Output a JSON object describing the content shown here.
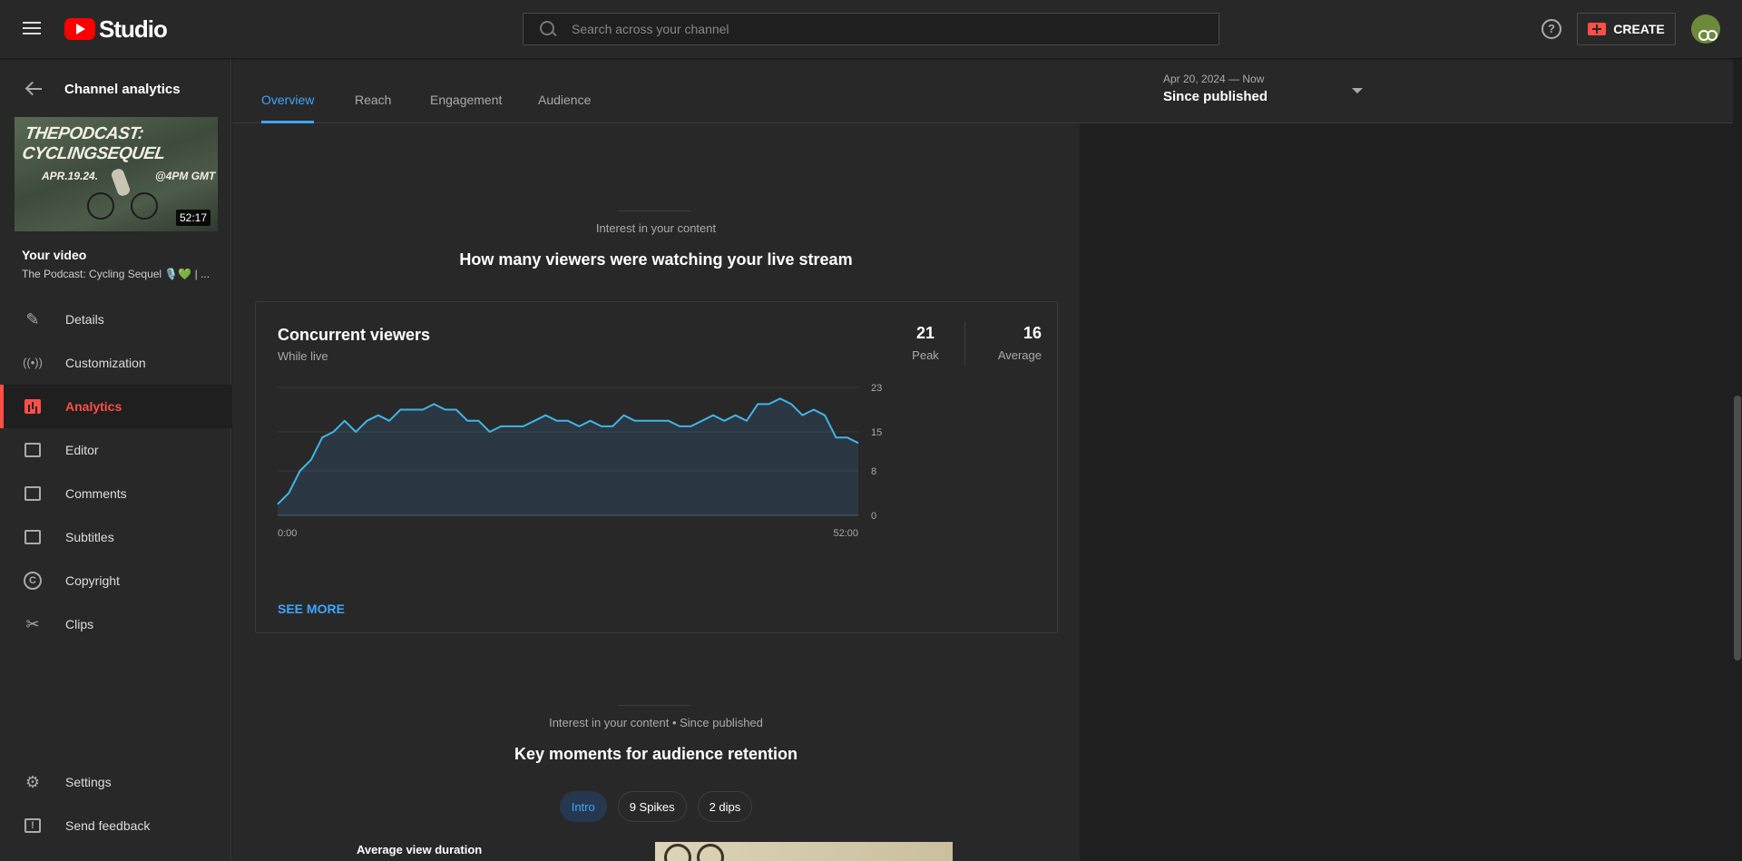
{
  "app": {
    "brand": "Studio",
    "search_placeholder": "Search across your channel",
    "help": "?",
    "create_label": "CREATE"
  },
  "sidebar": {
    "back_label": "Channel analytics",
    "thumbnail": {
      "title": "THEPODCAST: CYCLINGSEQUEL",
      "date": "APR.19.24.",
      "time": "@4PM GMT",
      "duration": "52:17"
    },
    "your_video_label": "Your video",
    "video_title": "The Podcast: Cycling Sequel 🎙️💚 | ...",
    "items": [
      {
        "label": "Details",
        "icon": "pencil-icon"
      },
      {
        "label": "Customization",
        "icon": "broadcast-icon"
      },
      {
        "label": "Analytics",
        "icon": "bar-chart-icon"
      },
      {
        "label": "Editor",
        "icon": "film-icon"
      },
      {
        "label": "Comments",
        "icon": "comment-icon"
      },
      {
        "label": "Subtitles",
        "icon": "subtitles-icon"
      },
      {
        "label": "Copyright",
        "icon": "copyright-icon"
      },
      {
        "label": "Clips",
        "icon": "scissors-icon"
      }
    ],
    "bottom_items": [
      {
        "label": "Settings",
        "icon": "gear-icon"
      },
      {
        "label": "Send feedback",
        "icon": "feedback-icon"
      }
    ]
  },
  "tabs": [
    {
      "label": "Overview",
      "active": true
    },
    {
      "label": "Reach",
      "active": false
    },
    {
      "label": "Engagement",
      "active": false
    },
    {
      "label": "Audience",
      "active": false
    }
  ],
  "date_range": {
    "sub": "Apr 20, 2024 — Now",
    "main": "Since published"
  },
  "section1": {
    "kicker": "Interest in your content",
    "title": "How many viewers were watching your live stream"
  },
  "card": {
    "title": "Concurrent viewers",
    "subtitle": "While live",
    "peak_value": "21",
    "peak_label": "Peak",
    "avg_value": "16",
    "avg_label": "Average",
    "see_more": "SEE MORE"
  },
  "chart_data": {
    "type": "area",
    "title": "",
    "xlabel": "",
    "ylabel": "",
    "x_tick_labels": [
      "0:00",
      "52:00"
    ],
    "y_ticks": [
      0,
      8,
      15,
      23
    ],
    "ylim": [
      0,
      23
    ],
    "grid": true,
    "color": "#3ea6ff",
    "values": [
      2,
      4,
      8,
      10,
      14,
      15,
      17,
      15,
      17,
      18,
      17,
      19,
      19,
      19,
      20,
      19,
      19,
      17,
      17,
      15,
      16,
      16,
      16,
      17,
      18,
      17,
      17,
      16,
      17,
      16,
      16,
      18,
      17,
      17,
      17,
      17,
      16,
      16,
      17,
      18,
      17,
      18,
      17,
      20,
      20,
      21,
      20,
      18,
      19,
      18,
      14,
      14,
      13
    ]
  },
  "section2": {
    "kicker": "Interest in your content • Since published",
    "title": "Key moments for audience retention",
    "chips": [
      {
        "label": "Intro",
        "active": true
      },
      {
        "label": "9 Spikes",
        "active": false
      },
      {
        "label": "2 dips",
        "active": false
      }
    ],
    "avg_view_duration_label": "Average view duration"
  }
}
